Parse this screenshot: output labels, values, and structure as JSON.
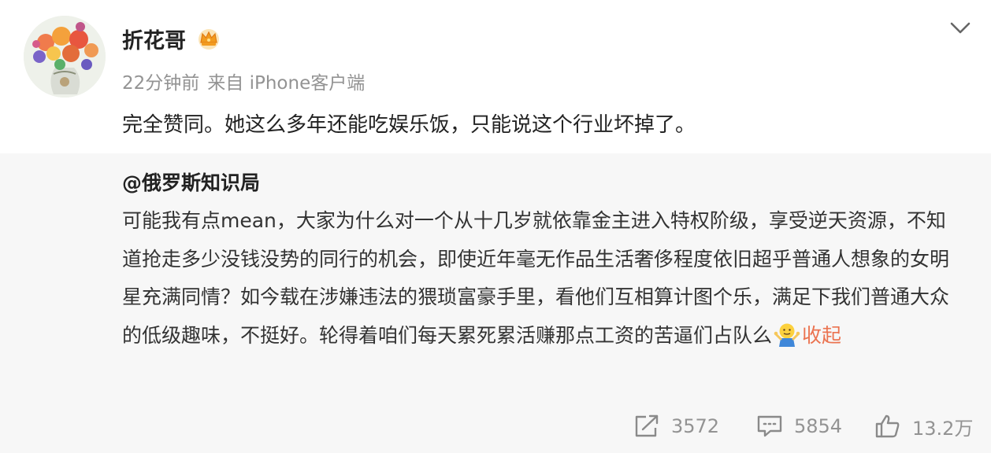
{
  "post": {
    "author_name": "折花哥",
    "time": "22分钟前",
    "source": "来自 iPhone客户端",
    "text": "完全赞同。她这么多年还能吃娱乐饭，只能说这个行业坏掉了。"
  },
  "repost": {
    "author": "@俄罗斯知识局",
    "text": "可能我有点mean，大家为什么对一个从十几岁就依靠金主进入特权阶级，享受逆天资源，不知道抢走多少没钱没势的同行的机会，即使近年毫无作品生活奢侈程度依旧超乎普通人想象的女明星充满同情？如今载在涉嫌违法的猥琐富豪手里，看他们互相算计图个乐，满足下我们普通大众的低级趣味，不挺好。轮得着咱们每天累死累活赚那点工资的苦逼们占队么",
    "collapse_label": "收起"
  },
  "actions": {
    "repost_count": "3572",
    "comment_count": "5854",
    "like_count": "13.2万"
  },
  "icons": {
    "avatar": "flower-bouquet-photo",
    "badge": "crown-icon",
    "menu": "chevron-down-icon",
    "emoji": "shrug-emoji",
    "repost": "share-icon",
    "comment": "comment-icon",
    "like": "thumbs-up-icon"
  },
  "colors": {
    "link": "#eb7350",
    "muted": "#939393",
    "repost_bg": "#f7f7f7"
  }
}
